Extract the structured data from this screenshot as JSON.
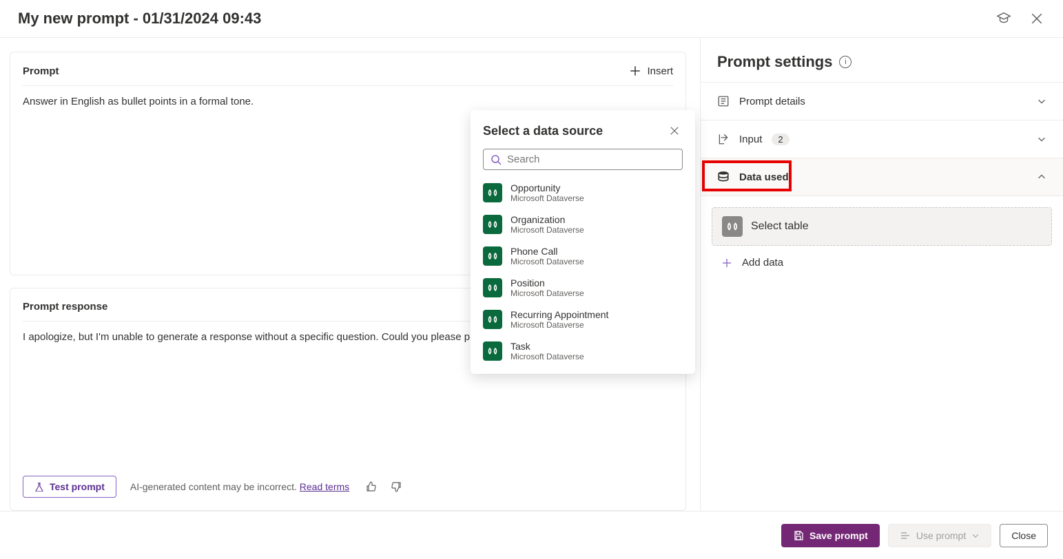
{
  "header": {
    "title": "My new prompt - 01/31/2024 09:43"
  },
  "prompt_card": {
    "title": "Prompt",
    "insert_label": "Insert",
    "body": "Answer in English as bullet points in a formal tone."
  },
  "response_card": {
    "title": "Prompt response",
    "body": "I apologize, but I'm unable to generate a response without a specific question. Could you please provide",
    "test_label": "Test prompt",
    "ai_note": "AI-generated content may be incorrect.",
    "terms_label": "Read terms"
  },
  "settings": {
    "title": "Prompt settings",
    "details_label": "Prompt details",
    "input_label": "Input",
    "input_count": "2",
    "data_used_label": "Data used",
    "select_table_label": "Select table",
    "add_data_label": "Add data"
  },
  "popup": {
    "title": "Select a data source",
    "search_placeholder": "Search",
    "items": [
      {
        "name": "Opportunity",
        "sub": "Microsoft Dataverse"
      },
      {
        "name": "Organization",
        "sub": "Microsoft Dataverse"
      },
      {
        "name": "Phone Call",
        "sub": "Microsoft Dataverse"
      },
      {
        "name": "Position",
        "sub": "Microsoft Dataverse"
      },
      {
        "name": "Recurring Appointment",
        "sub": "Microsoft Dataverse"
      },
      {
        "name": "Task",
        "sub": "Microsoft Dataverse"
      }
    ]
  },
  "footer": {
    "save_label": "Save prompt",
    "use_label": "Use prompt",
    "close_label": "Close"
  }
}
